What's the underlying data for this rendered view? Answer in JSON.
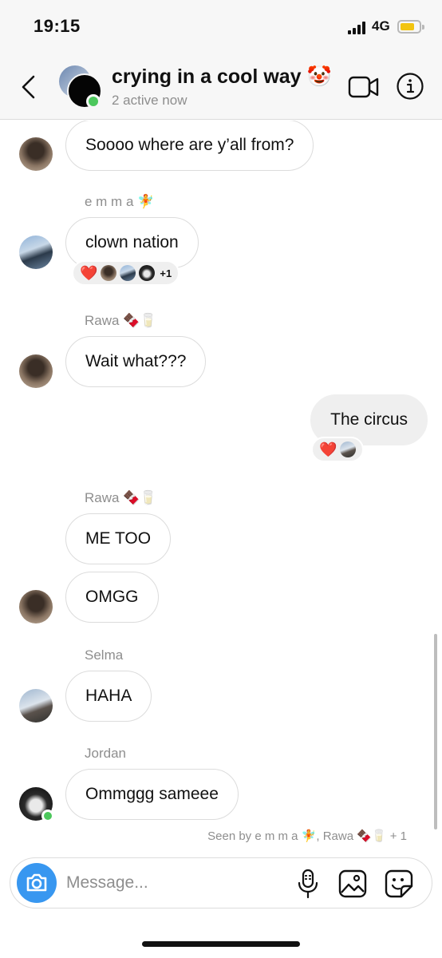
{
  "status_bar": {
    "time": "19:15",
    "network": "4G",
    "battery_level": 0.6,
    "icons": [
      "cellular-signal-icon",
      "battery-icon"
    ]
  },
  "header": {
    "title": "crying in a cool way 🤡",
    "subtitle": "2 active now",
    "icons": [
      "back-arrow-icon",
      "video-call-icon",
      "info-icon"
    ]
  },
  "messages": [
    {
      "sender": "",
      "text": "Soooo where are y’all from?",
      "direction": "incoming"
    },
    {
      "sender": "e m m a 🧚",
      "text": "clown nation",
      "direction": "incoming",
      "reactions": {
        "emoji": "❤️",
        "extra": "+1"
      }
    },
    {
      "sender": "Rawa 🍫🥛",
      "text": "Wait what???",
      "direction": "incoming"
    },
    {
      "sender": "",
      "text": "The circus",
      "direction": "outgoing",
      "reactions": {
        "emoji": "❤️"
      }
    },
    {
      "sender": "Rawa 🍫🥛",
      "text": "ME TOO",
      "direction": "incoming"
    },
    {
      "sender": "",
      "text": "OMGG",
      "direction": "incoming"
    },
    {
      "sender": "Selma",
      "text": "HAHA",
      "direction": "incoming"
    },
    {
      "sender": "Jordan",
      "text": "Ommggg sameee",
      "direction": "incoming"
    }
  ],
  "seen_by": "Seen by e m m a 🧚, Rawa 🍫🥛 + 1",
  "composer": {
    "placeholder": "Message...",
    "icons": [
      "camera-icon",
      "microphone-icon",
      "gallery-icon",
      "sticker-icon"
    ]
  },
  "colors": {
    "accent": "#3897f0",
    "online": "#4cc75c",
    "reaction_heart": "#e0245e",
    "incoming_bubble_border": "#dcdcdc",
    "outgoing_bubble": "#efefef",
    "muted_text": "#8e8e8e"
  }
}
